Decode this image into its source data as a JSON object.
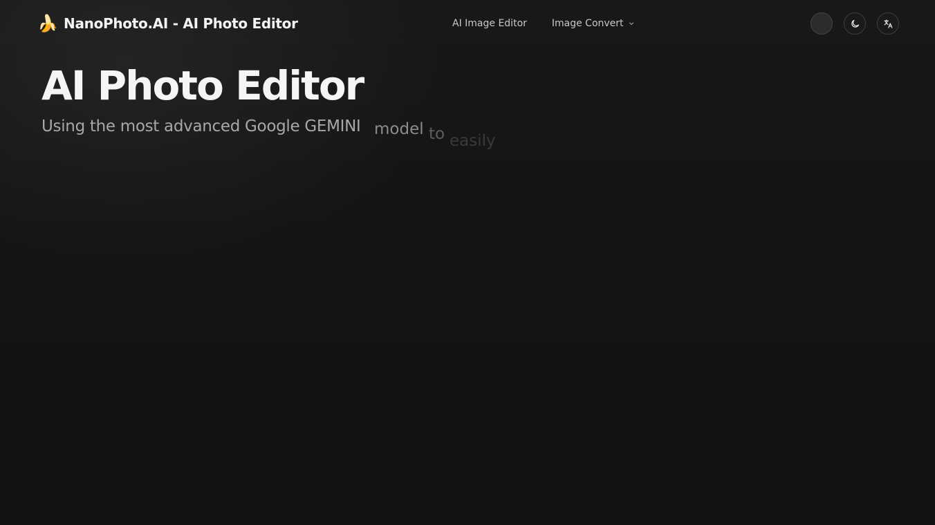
{
  "header": {
    "brand_icon": "banana-icon",
    "brand_emoji": "🍌",
    "brand_title": "NanoPhoto.AI - AI Photo Editor",
    "nav": [
      {
        "label": "AI Image Editor"
      },
      {
        "label": "Image Convert",
        "has_dropdown": true
      }
    ],
    "actions": [
      {
        "name": "avatar"
      },
      {
        "name": "theme-toggle",
        "icon": "moon-icon"
      },
      {
        "name": "language-switcher",
        "icon": "translate-icon"
      }
    ]
  },
  "hero": {
    "title": "AI Photo Editor",
    "subtitle_main": "Using the most advanced Google GEMINI",
    "subtitle_word_1": "model",
    "subtitle_word_2": "to",
    "subtitle_word_3": "easily"
  },
  "colors": {
    "background": "#131313",
    "title": "#f5f5f5",
    "subtitle": "#a8a8a8",
    "nav_text": "#c9c9c9"
  }
}
